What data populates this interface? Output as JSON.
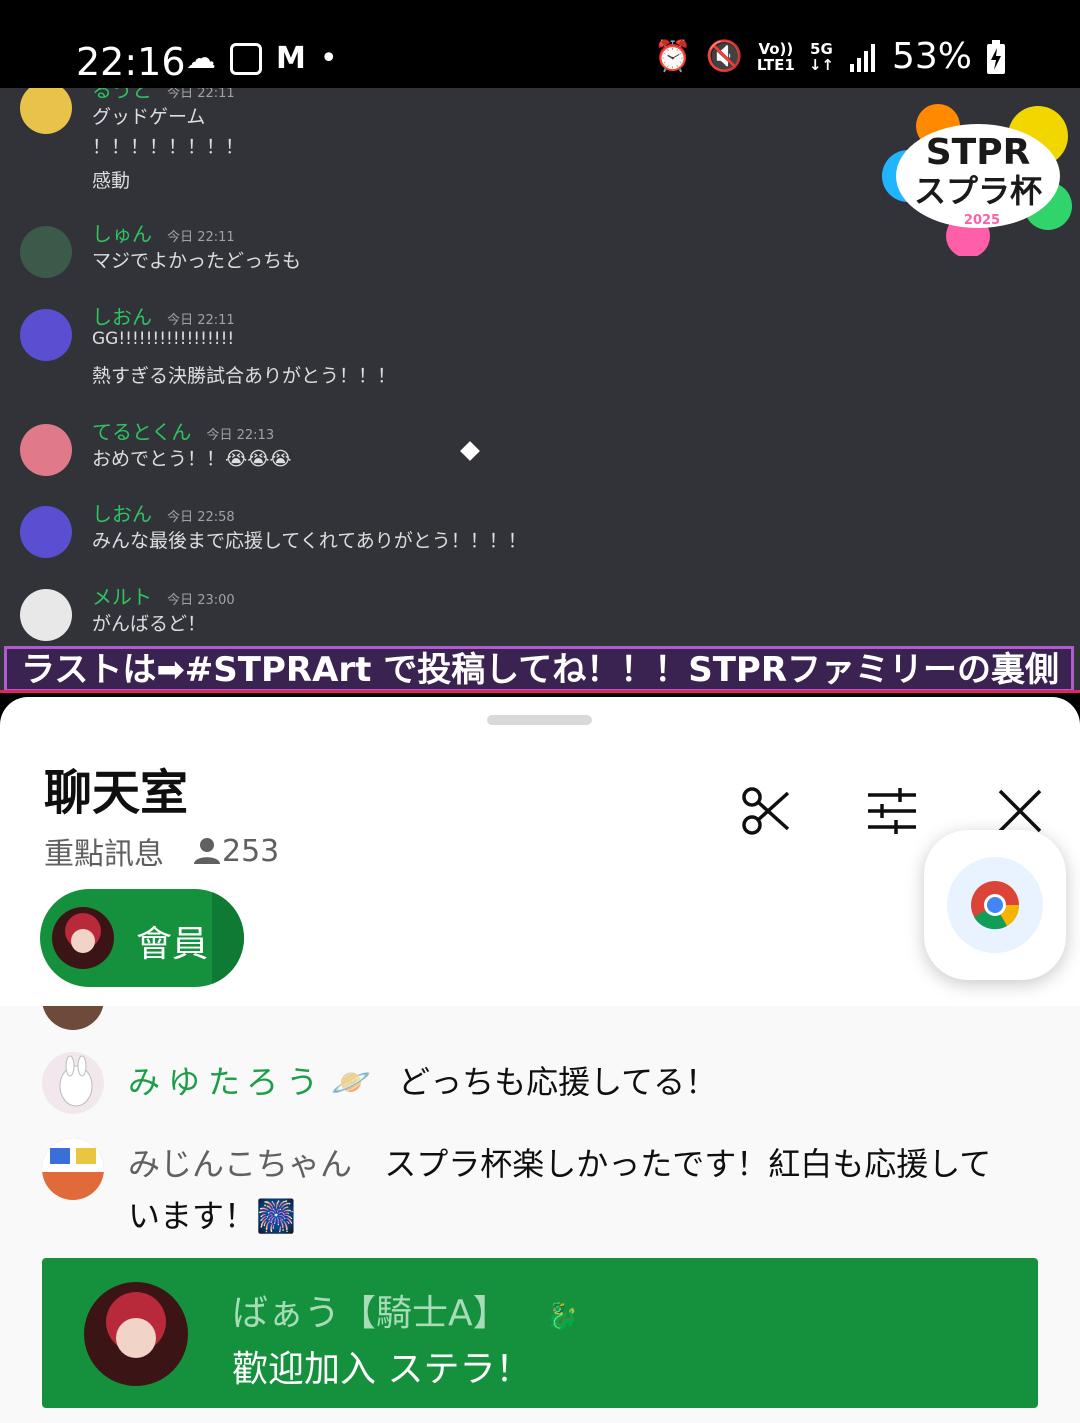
{
  "status_bar": {
    "time": "22:16",
    "left_icons": [
      "cloud-icon",
      "app-notification-icon",
      "gmail-icon",
      "dot-icon"
    ],
    "right_icons": [
      "alarm-icon",
      "mute-icon",
      "volte-icon",
      "5g-icon",
      "signal-icon",
      "battery-charging-icon"
    ],
    "volte_top": "Vo))",
    "volte_bottom": "LTE1",
    "net_top": "5G",
    "net_bottom": "↓↑",
    "battery": "53%"
  },
  "video": {
    "partial_top": {
      "name": "るうと",
      "time": "今日 22:11",
      "lines": [
        "グッドゲーム",
        "！！！！！！！！",
        "感動"
      ]
    },
    "messages": [
      {
        "name": "しゅん",
        "time": "今日 22:11",
        "lines": [
          "マジでよかったどっちも"
        ]
      },
      {
        "name": "しおん",
        "time": "今日 22:11",
        "lines": [
          "GG!!!!!!!!!!!!!!!!!",
          "熱すぎる決勝試合ありがとう！！！"
        ]
      },
      {
        "name": "てるとくん",
        "time": "今日 22:13",
        "lines": [
          "おめでとう！！😭😭😭"
        ]
      },
      {
        "name": "しおん",
        "time": "今日 22:58",
        "lines": [
          "みんな最後まで応援してくれてありがとう！！！！"
        ]
      },
      {
        "name": "メルト",
        "time": "今日 23:00",
        "lines": [
          "がんばるど！"
        ]
      }
    ],
    "logo": {
      "line1": "STPR",
      "line2": "スプラ杯",
      "year": "2025"
    },
    "ticker": "ラストは➡#STPRArt で投稿してね！！！STPRファミリーの裏側"
  },
  "panel": {
    "title": "聊天室",
    "subtitle": "重點訊息",
    "viewer_count": "253",
    "member_chip": "會員",
    "chat": [
      {
        "name": "みゆたろう",
        "emoji": "🪐",
        "text": "どっちも応援してる！"
      },
      {
        "name": "みじんこちゃん",
        "text": "スプラ杯楽しかったです！紅白も応援しています！🎆"
      }
    ],
    "welcome": {
      "name": "ばぁう【騎士A】",
      "badge": "🐉",
      "text": "歡迎加入 ステラ！"
    }
  },
  "colors": {
    "youtube_green": "#15913d",
    "discord_bg": "#313338",
    "discord_name": "#2ec35f"
  }
}
